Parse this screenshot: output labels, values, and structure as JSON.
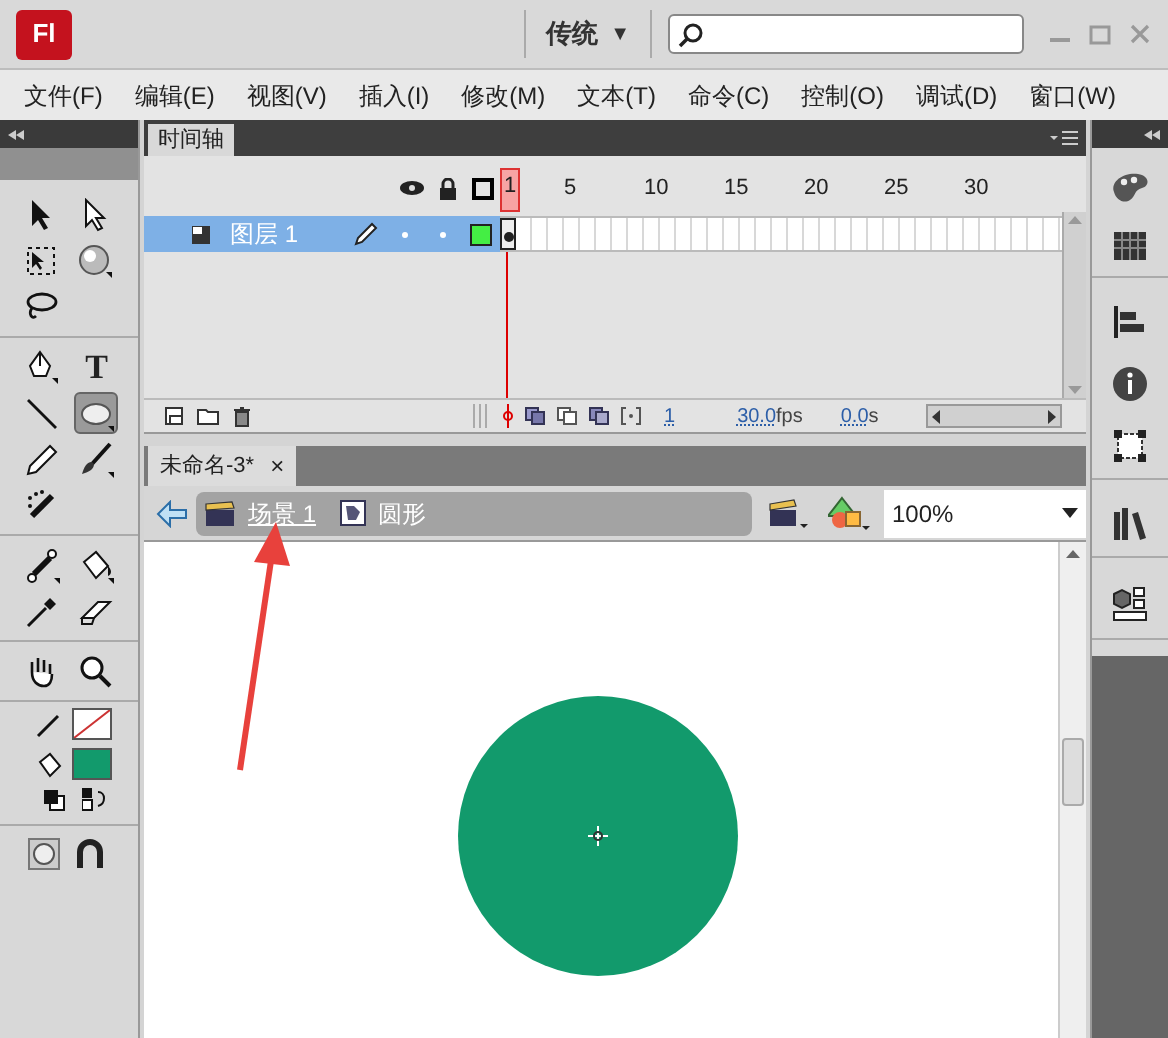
{
  "title_bar": {
    "logo": "Fl",
    "workspace": "传统",
    "workspace_caret": "▼"
  },
  "menu": [
    "文件(F)",
    "编辑(E)",
    "视图(V)",
    "插入(I)",
    "修改(M)",
    "文本(T)",
    "命令(C)",
    "控制(O)",
    "调试(D)",
    "窗口(W)"
  ],
  "tools": [
    [
      {
        "kind": "selection",
        "selected": false
      },
      {
        "kind": "subselection",
        "selected": false
      }
    ],
    [
      {
        "kind": "free-transform",
        "selected": false
      },
      {
        "kind": "rotate-3d",
        "selected": false
      }
    ],
    [
      {
        "kind": "lasso",
        "selected": false
      }
    ],
    [
      {
        "kind": "pen",
        "selected": false
      },
      {
        "kind": "text",
        "label": "T",
        "selected": false
      }
    ],
    [
      {
        "kind": "line",
        "selected": false
      },
      {
        "kind": "oval",
        "selected": true
      }
    ],
    [
      {
        "kind": "pencil",
        "selected": false
      },
      {
        "kind": "brush",
        "selected": false
      }
    ],
    [
      {
        "kind": "deco",
        "selected": false
      }
    ],
    [
      {
        "kind": "bone",
        "selected": false
      },
      {
        "kind": "bucket",
        "selected": false
      }
    ],
    [
      {
        "kind": "eyedropper",
        "selected": false
      },
      {
        "kind": "eraser",
        "selected": false
      }
    ],
    [
      {
        "kind": "hand",
        "selected": false
      },
      {
        "kind": "zoom",
        "selected": false
      }
    ]
  ],
  "colors": {
    "stroke_none": true,
    "fill": {
      "color": "#129a6c"
    }
  },
  "timeline": {
    "tab": "时间轴",
    "frame_labels": [
      "1",
      "5",
      "10",
      "15",
      "20",
      "25",
      "30"
    ],
    "layers": [
      {
        "name": "图层 1",
        "selected": true,
        "editing": true,
        "keyframe": true
      }
    ],
    "current_frame": "1",
    "frame_rate": {
      "value": "30.0",
      "unit": "fps"
    },
    "elapsed": {
      "value": "0.0",
      "unit": "s"
    }
  },
  "document": {
    "tab": "未命名-3*",
    "close": "×",
    "breadcrumb": [
      "场景 1",
      "圆形"
    ],
    "zoom": "100%"
  }
}
